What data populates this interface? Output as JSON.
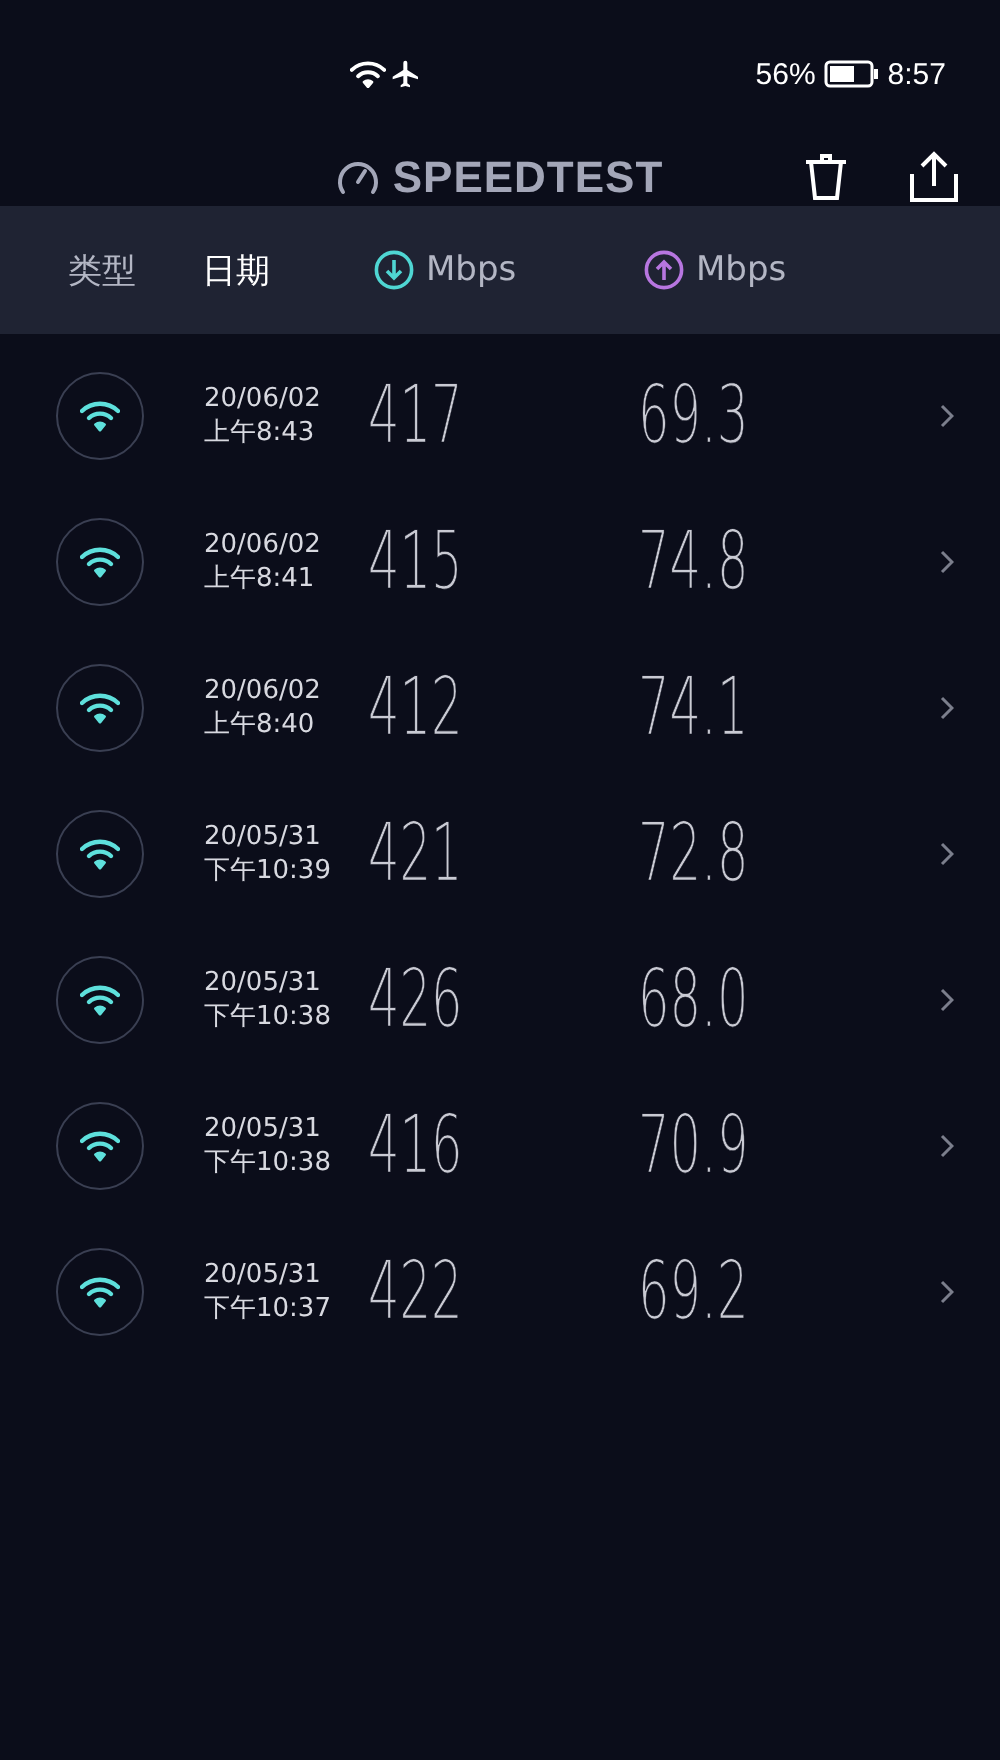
{
  "status_bar": {
    "battery": "56%",
    "time": "8:57"
  },
  "app_bar": {
    "title": "SPEEDTEST"
  },
  "columns": [
    {
      "kind": "text",
      "label": "类型",
      "selected": false
    },
    {
      "kind": "text",
      "label": "日期",
      "selected": true
    },
    {
      "kind": "download",
      "label": "Mbps",
      "selected": false
    },
    {
      "kind": "upload",
      "label": "Mbps",
      "selected": false
    }
  ],
  "results": [
    {
      "date": "20/06/02",
      "time": "上午8:43",
      "download": "417",
      "upload": "69.3"
    },
    {
      "date": "20/06/02",
      "time": "上午8:41",
      "download": "415",
      "upload": "74.8"
    },
    {
      "date": "20/06/02",
      "time": "上午8:40",
      "download": "412",
      "upload": "74.1"
    },
    {
      "date": "20/05/31",
      "time": "下午10:39",
      "download": "421",
      "upload": "72.8"
    },
    {
      "date": "20/05/31",
      "time": "下午10:38",
      "download": "426",
      "upload": "68.0"
    },
    {
      "date": "20/05/31",
      "time": "下午10:38",
      "download": "416",
      "upload": "70.9"
    },
    {
      "date": "20/05/31",
      "time": "下午10:37",
      "download": "422",
      "upload": "69.2"
    }
  ]
}
